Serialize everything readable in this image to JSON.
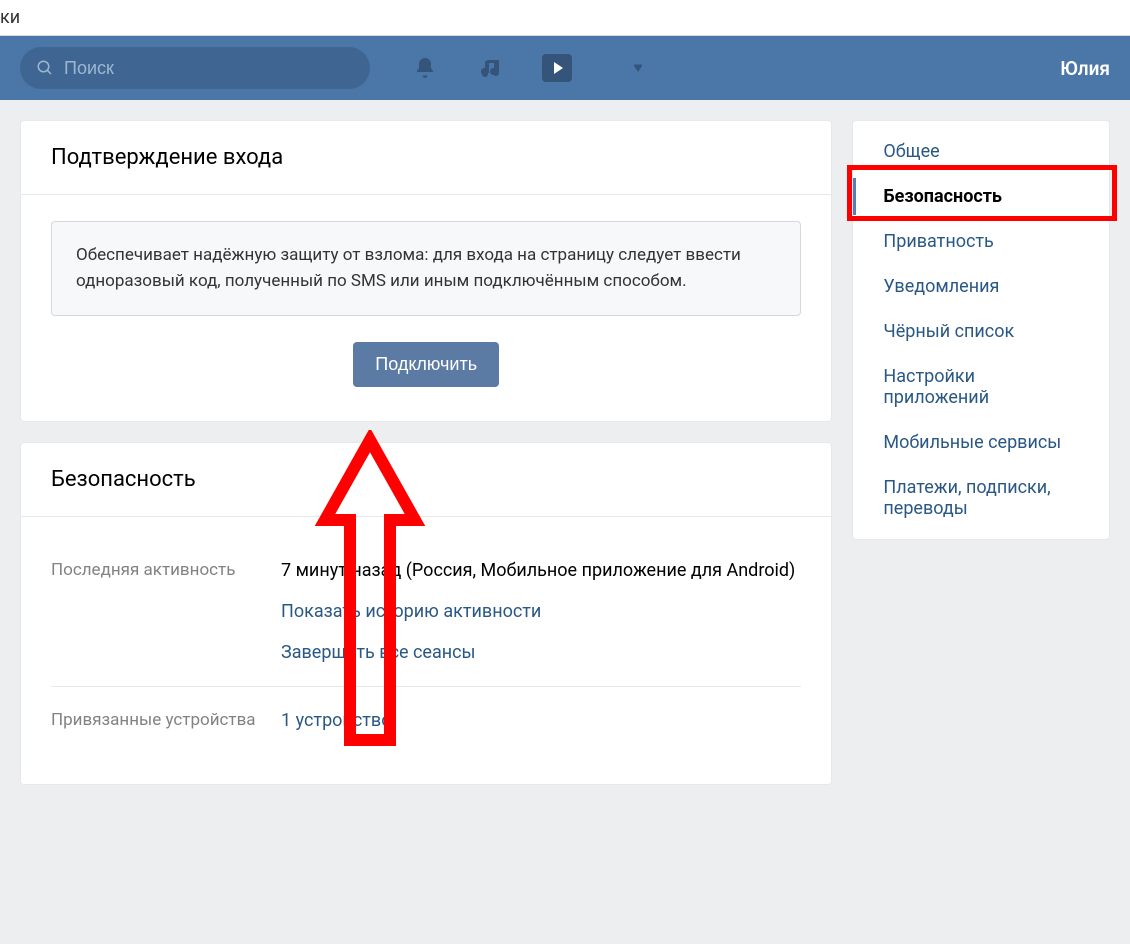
{
  "tab_fragment": "ки",
  "header": {
    "search_placeholder": "Поиск",
    "user_name": "Юлия"
  },
  "confirmation_card": {
    "title": "Подтверждение входа",
    "info": "Обеспечивает надёжную защиту от взлома: для входа на страницу следует ввести одноразовый код, полученный по SMS или иным подключённым способом.",
    "connect_btn": "Подключить"
  },
  "security_card": {
    "title": "Безопасность",
    "rows": {
      "last_activity_label": "Последняя активность",
      "last_activity_value": "7 минут назад (Россия, Мобильное приложение для Android)",
      "show_history": "Показать историю активности",
      "end_sessions": "Завершить все сеансы",
      "devices_label": "Привязанные устройства",
      "devices_value": "1 устройство"
    }
  },
  "sidebar": {
    "items": [
      {
        "label": "Общее"
      },
      {
        "label": "Безопасность"
      },
      {
        "label": "Приватность"
      },
      {
        "label": "Уведомления"
      },
      {
        "label": "Чёрный список"
      },
      {
        "label": "Настройки приложений"
      },
      {
        "label": "Мобильные сервисы"
      },
      {
        "label": "Платежи, подписки, переводы"
      }
    ]
  },
  "annotations": {
    "highlight_color": "#ff0000"
  }
}
